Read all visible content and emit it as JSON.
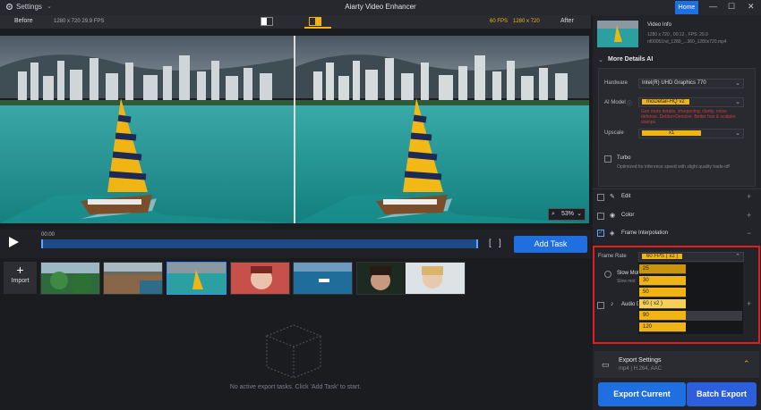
{
  "titlebar": {
    "settings_label": "Settings",
    "app_title": "Aiarty Video Enhancer",
    "home_label": "Home",
    "minimize": "—",
    "maximize": "☐",
    "close": "✕"
  },
  "compare_bar": {
    "before_label": "Before",
    "before_info": "1280 x 720  29.9 FPS",
    "after_info_fps": "60 FPS",
    "after_info_res": "1280 x 720",
    "after_label": "After"
  },
  "preview": {
    "zoom_level": "53%"
  },
  "timeline": {
    "time": "00:00",
    "add_task_label": "Add Task"
  },
  "import": {
    "plus": "+",
    "label": "Import"
  },
  "thumbnails": [
    {
      "name": "forest-clip"
    },
    {
      "name": "coast-town-clip"
    },
    {
      "name": "sailboat-clip"
    },
    {
      "name": "woman-red-clip"
    },
    {
      "name": "ocean-boat-clip"
    },
    {
      "name": "woman-dark-clip"
    },
    {
      "name": "woman-blonde-clip"
    }
  ],
  "export_area": {
    "empty_message": "No active export tasks. Click 'Add Task' to start."
  },
  "right_panel": {
    "video_info_title": "Video Info",
    "video_info_line1": "1280 x 720 , 00:12 , FPS: 29.9",
    "video_info_line2": "nf00051hd_1280_...360_1280x720.mp4",
    "section_title": "More Details AI",
    "hardware_label": "Hardware",
    "hardware_value": "Intel(R) UHD Graphics 770",
    "ai_model_label": "AI Model",
    "ai_model_value": "moDetail-HQ  v2",
    "ai_model_desc": "Gen more details, sharpening, clarity, noise defense. Deblur+Denoise. Better hair & scalpier stamps",
    "upscale_label": "Upscale",
    "upscale_value": "x1",
    "turbo_label": "Turbo",
    "turbo_desc": "Optimized for inference speed with slight quality trade-off",
    "edit_label": "Edit",
    "color_label": "Color",
    "frame_interp_label": "Frame Interpolation",
    "frame_rate_label": "Frame Rate",
    "frame_rate_value": "60 FPS ( x2 )",
    "slow_motion_label": "Slow Mot",
    "slow_motion_sub": "Slow mot",
    "audio_label": "Audio D",
    "frame_rate_options": [
      "25",
      "30",
      "50",
      "60 ( x2 )",
      "90",
      "120"
    ],
    "export_settings_title": "Export Settings",
    "export_settings_sub": "mp4 | H.264, AAC",
    "export_current_label": "Export Current",
    "batch_export_label": "Batch Export"
  },
  "colors": {
    "accent_blue": "#1f6fe0",
    "highlight_yellow": "#f0b515",
    "alert_red": "#e11d1d"
  }
}
